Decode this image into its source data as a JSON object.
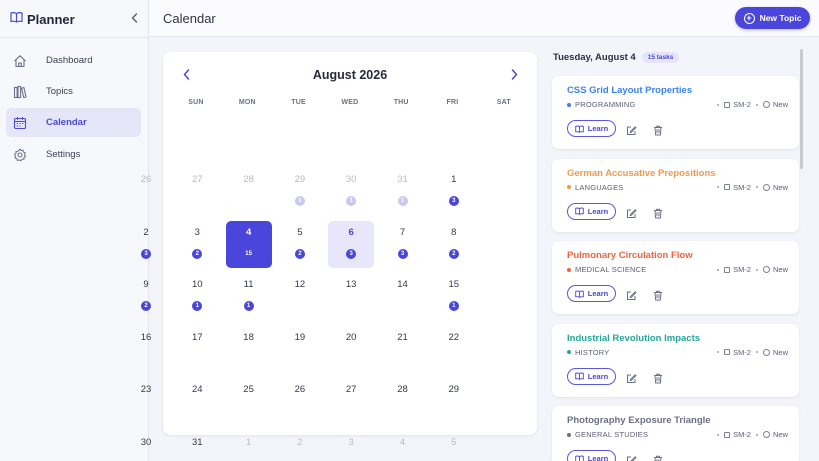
{
  "app": {
    "name": "Planner"
  },
  "sidebar": {
    "items": [
      {
        "label": "Dashboard",
        "icon": "home-icon"
      },
      {
        "label": "Topics",
        "icon": "books-icon"
      },
      {
        "label": "Calendar",
        "icon": "calendar-icon",
        "active": true
      },
      {
        "label": "Settings",
        "icon": "gear-icon"
      }
    ]
  },
  "header": {
    "title": "Calendar",
    "new_button": "New Topic"
  },
  "calendar": {
    "month_label": "August 2026",
    "weekdays": [
      "SUN",
      "MON",
      "TUE",
      "WED",
      "THU",
      "FRI",
      "SAT"
    ],
    "days": [
      {
        "n": "26",
        "muted": true
      },
      {
        "n": "27",
        "muted": true
      },
      {
        "n": "28",
        "muted": true
      },
      {
        "n": "29",
        "muted": true,
        "count": "1"
      },
      {
        "n": "30",
        "muted": true,
        "count": "1"
      },
      {
        "n": "31",
        "muted": true,
        "count": "1"
      },
      {
        "n": "1",
        "count": "3"
      },
      {
        "n": "2",
        "count": "3"
      },
      {
        "n": "3",
        "count": "2"
      },
      {
        "n": "4",
        "count": "15",
        "selected": true
      },
      {
        "n": "5",
        "count": "2"
      },
      {
        "n": "6",
        "count": "3",
        "today": true
      },
      {
        "n": "7",
        "count": "3"
      },
      {
        "n": "8",
        "count": "2"
      },
      {
        "n": "9",
        "count": "2"
      },
      {
        "n": "10",
        "count": "1"
      },
      {
        "n": "11",
        "count": "1"
      },
      {
        "n": "12"
      },
      {
        "n": "13"
      },
      {
        "n": "14"
      },
      {
        "n": "15",
        "count": "1"
      },
      {
        "n": "16"
      },
      {
        "n": "17"
      },
      {
        "n": "18"
      },
      {
        "n": "19"
      },
      {
        "n": "20"
      },
      {
        "n": "21"
      },
      {
        "n": "22"
      },
      {
        "n": "23"
      },
      {
        "n": "24"
      },
      {
        "n": "25"
      },
      {
        "n": "26"
      },
      {
        "n": "27"
      },
      {
        "n": "28"
      },
      {
        "n": "29"
      },
      {
        "n": "30"
      },
      {
        "n": "31"
      },
      {
        "n": "1",
        "muted": true
      },
      {
        "n": "2",
        "muted": true
      },
      {
        "n": "3",
        "muted": true
      },
      {
        "n": "4",
        "muted": true
      },
      {
        "n": "5",
        "muted": true
      }
    ]
  },
  "panel": {
    "date": "Tuesday, August 4",
    "count": "15 tasks",
    "tasks": [
      {
        "title": "CSS Grid Layout Properties",
        "category": "PROGRAMMING",
        "color": "#3b82f6",
        "level": "SM-2",
        "status": "New",
        "learn": "Learn"
      },
      {
        "title": "German Accusative Prepositions",
        "category": "LANGUAGES",
        "color": "#f2994a",
        "level": "SM-2",
        "status": "New",
        "learn": "Learn"
      },
      {
        "title": "Pulmonary Circulation Flow",
        "category": "MEDICAL SCIENCE",
        "color": "#f0643c",
        "level": "SM-2",
        "status": "New",
        "learn": "Learn"
      },
      {
        "title": "Industrial Revolution Impacts",
        "category": "HISTORY",
        "color": "#26a69a",
        "level": "SM-2",
        "status": "New",
        "learn": "Learn"
      },
      {
        "title": "Photography Exposure Triangle",
        "category": "GENERAL STUDIES",
        "color": "#6b7086",
        "level": "SM-2",
        "status": "New",
        "learn": "Learn"
      }
    ]
  }
}
